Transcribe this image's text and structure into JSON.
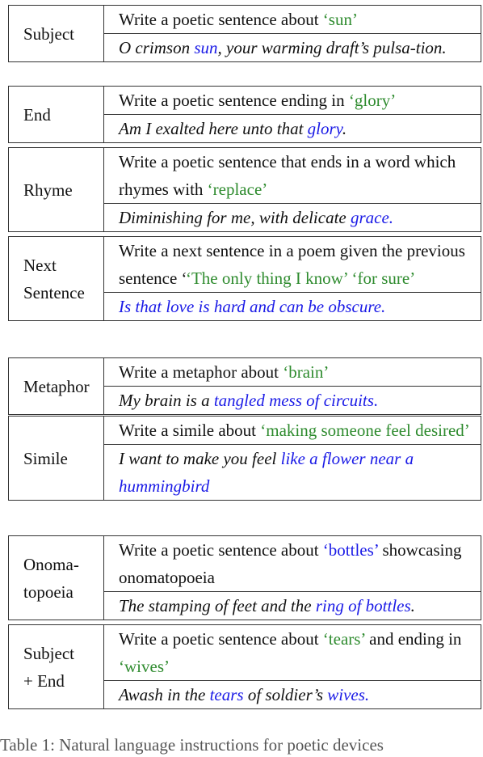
{
  "rows": [
    {
      "label": "Subject",
      "instruction": [
        {
          "t": "Write a poetic sentence about "
        },
        {
          "t": "‘sun’",
          "c": "g"
        }
      ],
      "output": [
        {
          "t": "O crimson "
        },
        {
          "t": "sun",
          "c": "b"
        },
        {
          "t": ", your warming draft’s pulsa-tion."
        }
      ]
    },
    {
      "label": "End",
      "instruction": [
        {
          "t": "Write a poetic sentence ending in "
        },
        {
          "t": "‘glory’",
          "c": "g"
        }
      ],
      "output": [
        {
          "t": "Am I exalted here unto that "
        },
        {
          "t": "glory",
          "c": "b"
        },
        {
          "t": "."
        }
      ]
    },
    {
      "label": "Rhyme",
      "instruction": [
        {
          "t": "Write a poetic sentence that ends in a word which rhymes with "
        },
        {
          "t": "‘replace’",
          "c": "g"
        }
      ],
      "output": [
        {
          "t": "Diminishing for me, with delicate "
        },
        {
          "t": "grace.",
          "c": "b"
        }
      ]
    },
    {
      "label": "Next Sentence",
      "instruction": [
        {
          "t": "Write a next sentence in a poem given the previous sentence ‘"
        },
        {
          "t": "‘The only thing I know’ ‘for sure’",
          "c": "g"
        }
      ],
      "output": [
        {
          "t": "Is that love is hard and can be obscure.",
          "c": "b"
        }
      ]
    },
    {
      "label": "Metaphor",
      "instruction": [
        {
          "t": "Write a metaphor about "
        },
        {
          "t": "‘brain’",
          "c": "g"
        }
      ],
      "output": [
        {
          "t": "My brain is a "
        },
        {
          "t": "tangled mess of circuits.",
          "c": "b"
        }
      ]
    },
    {
      "label": "Simile",
      "instruction": [
        {
          "t": "Write a simile about "
        },
        {
          "t": "‘making someone feel desired’",
          "c": "g"
        }
      ],
      "output": [
        {
          "t": "I want to make you feel "
        },
        {
          "t": "like a flower near a hummingbird",
          "c": "b"
        }
      ]
    },
    {
      "label": "Onoma-topoeia",
      "instruction": [
        {
          "t": "Write a poetic sentence about "
        },
        {
          "t": "‘bottles’",
          "c": "b"
        },
        {
          "t": " showcasing onomatopoeia"
        }
      ],
      "output": [
        {
          "t": "The stamping of feet and the "
        },
        {
          "t": "ring of bottles",
          "c": "b"
        },
        {
          "t": "."
        }
      ]
    },
    {
      "label": "Subject + End",
      "instruction": [
        {
          "t": "Write a poetic sentence about "
        },
        {
          "t": "‘tears’",
          "c": "g"
        },
        {
          "t": " and ending in "
        },
        {
          "t": "‘wives’",
          "c": "g"
        }
      ],
      "output": [
        {
          "t": "Awash in the "
        },
        {
          "t": "tears",
          "c": "b"
        },
        {
          "t": " of soldier’s "
        },
        {
          "t": "wives.",
          "c": "b"
        }
      ]
    }
  ],
  "caption": "Table 1: Natural language instructions for poetic devices",
  "colors": {
    "highlight_green": "#2e8b2e",
    "highlight_blue": "#1a1ae6"
  }
}
